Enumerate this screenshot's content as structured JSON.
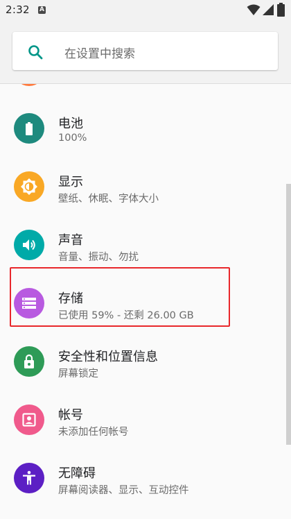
{
  "status_bar": {
    "time": "2:32",
    "notification_letter": "A"
  },
  "search": {
    "placeholder": "在设置中搜索",
    "icon": "search-icon"
  },
  "colors": {
    "accent": "#009688",
    "battery": "#1e8a7e",
    "display": "#f9a825",
    "sound": "#00aaa8",
    "storage": "#b85ae0",
    "security": "#2e9b57",
    "accounts": "#f05a8c",
    "accessibility": "#5c1fc4",
    "highlight": "#e8272b"
  },
  "settings_list": [
    {
      "title": "电池",
      "subtitle": "100%",
      "icon": "battery-icon"
    },
    {
      "title": "显示",
      "subtitle": "壁纸、休眠、字体大小",
      "icon": "brightness-icon"
    },
    {
      "title": "声音",
      "subtitle": "音量、振动、勿扰",
      "icon": "volume-icon"
    },
    {
      "title": "存储",
      "subtitle": "已使用 59% - 还剩 26.00 GB",
      "icon": "storage-icon"
    },
    {
      "title": "安全性和位置信息",
      "subtitle": "屏幕锁定",
      "icon": "lock-icon"
    },
    {
      "title": "帐号",
      "subtitle": "未添加任何帐号",
      "icon": "account-box-icon"
    },
    {
      "title": "无障碍",
      "subtitle": "屏幕阅读器、显示、互动控件",
      "icon": "accessibility-icon"
    }
  ]
}
